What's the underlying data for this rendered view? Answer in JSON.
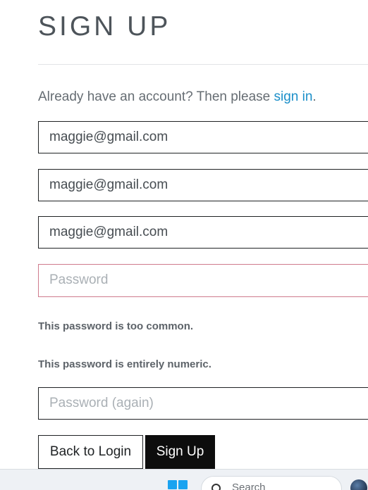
{
  "header": {
    "title": "SIGN UP"
  },
  "intro": {
    "text": "Already have an account? Then please ",
    "link": "sign in",
    "suffix": "."
  },
  "form": {
    "field1_value": "maggie@gmail.com",
    "field2_value": "maggie@gmail.com",
    "field3_value": "maggie@gmail.com",
    "password_placeholder": "Password",
    "password_again_placeholder": "Password (again)",
    "errors": [
      "This password is too common.",
      "This password is entirely numeric."
    ]
  },
  "buttons": {
    "back": "Back to Login",
    "signup": "Sign Up"
  },
  "taskbar": {
    "search_placeholder": "Search",
    "windows_icon": "windows-logo-icon",
    "search_icon": "search-icon"
  },
  "colors": {
    "link": "#1b8fc9",
    "error_border": "#cf7b8d",
    "primary_button": "#0d0d0d",
    "windows_blue": "#1aa3f0"
  }
}
